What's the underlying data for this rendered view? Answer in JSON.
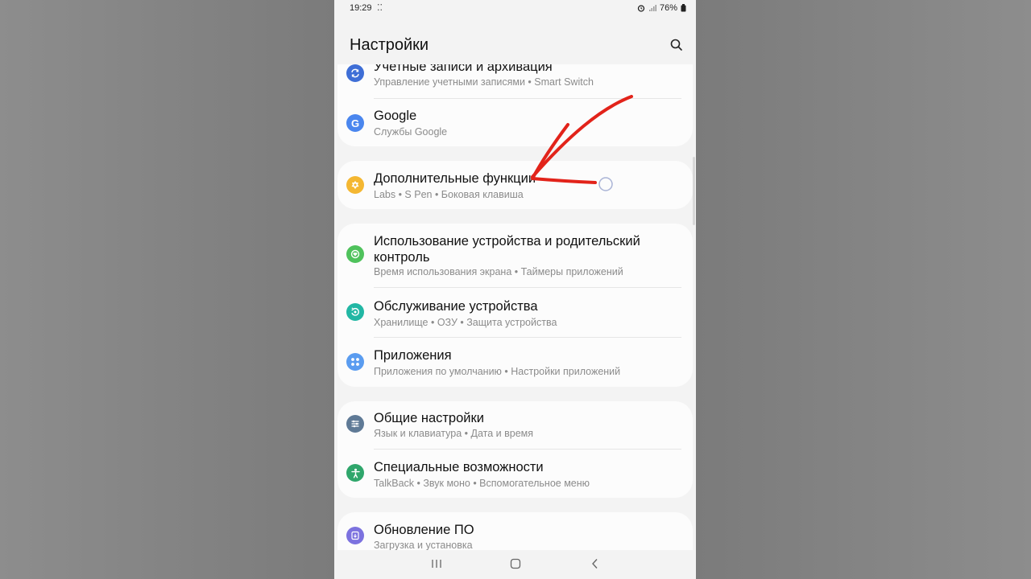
{
  "status": {
    "time": "19:29",
    "notification_dots": "⁚⁚",
    "battery": "76%"
  },
  "header": {
    "title": "Настройки"
  },
  "groups": [
    {
      "items": [
        {
          "title": "Учетные записи и архивация",
          "sub": "Управление учетными записями  •  Smart Switch",
          "icon": "sync-icon",
          "color": "#3e6ed6"
        },
        {
          "title": "Google",
          "sub": "Службы Google",
          "icon": "google-icon",
          "color": "#4a86ee"
        }
      ]
    },
    {
      "items": [
        {
          "title": "Дополнительные функции",
          "sub": "Labs  •  S Pen  •  Боковая клавиша",
          "icon": "advanced-features-icon",
          "color": "#f4b732"
        }
      ]
    },
    {
      "items": [
        {
          "title": "Использование устройства и родительский",
          "title2": "контроль",
          "sub": "Время использования экрана  •  Таймеры приложений",
          "icon": "digital-wellbeing-icon",
          "color": "#4fc25c"
        },
        {
          "title": "Обслуживание устройства",
          "sub": "Хранилище  •  ОЗУ  •  Защита устройства",
          "icon": "device-care-icon",
          "color": "#22b7a4"
        },
        {
          "title": "Приложения",
          "sub": "Приложения по умолчанию  •  Настройки приложений",
          "icon": "apps-icon",
          "color": "#5a9cf0"
        }
      ]
    },
    {
      "items": [
        {
          "title": "Общие настройки",
          "sub": "Язык и клавиатура  •  Дата и время",
          "icon": "general-management-icon",
          "color": "#5f7a96"
        },
        {
          "title": "Специальные возможности",
          "sub": "TalkBack  •  Звук моно  •  Вспомогательное меню",
          "icon": "accessibility-icon",
          "color": "#2fa66b"
        }
      ]
    },
    {
      "items": [
        {
          "title": "Обновление ПО",
          "sub": "Загрузка и установка",
          "icon": "software-update-icon",
          "color": "#7c72df"
        }
      ]
    }
  ],
  "colors": {
    "annotation_arrow": "#e2231a",
    "background": "#f3f3f3",
    "card": "#fcfcfc"
  }
}
